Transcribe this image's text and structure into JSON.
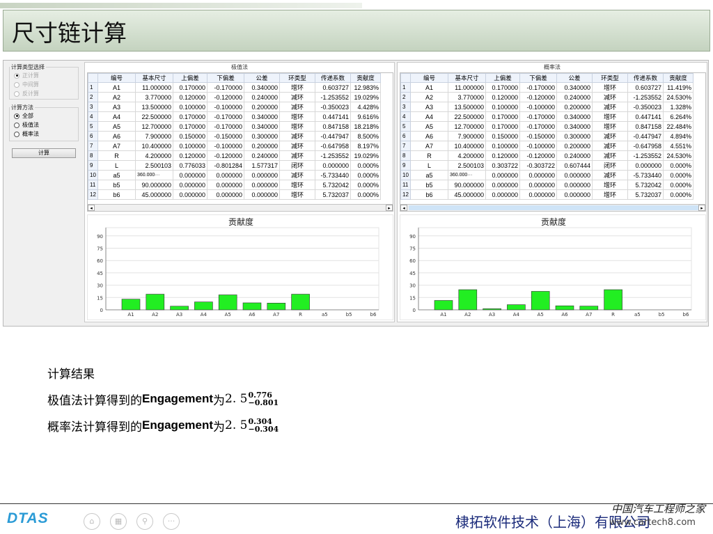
{
  "slide_title": "尺寸链计算",
  "left": {
    "group1_title": "计算类型选择",
    "group1_options": [
      "正计算",
      "中间算",
      "反计算"
    ],
    "group2_title": "计算方法",
    "group2_options": [
      "全部",
      "极值法",
      "概率法"
    ],
    "calc_button": "计算"
  },
  "table_headers": [
    "编号",
    "基本尺寸",
    "上偏差",
    "下偏差",
    "公差",
    "环类型",
    "传递系数",
    "贡献度"
  ],
  "extreme": {
    "title": "极值法",
    "rows": [
      [
        "1",
        "A1",
        "11.000000",
        "0.170000",
        "-0.170000",
        "0.340000",
        "增环",
        "0.603727",
        "12.983%"
      ],
      [
        "2",
        "A2",
        "3.770000",
        "0.120000",
        "-0.120000",
        "0.240000",
        "减环",
        "-1.253552",
        "19.029%"
      ],
      [
        "3",
        "A3",
        "13.500000",
        "0.100000",
        "-0.100000",
        "0.200000",
        "减环",
        "-0.350023",
        "4.428%"
      ],
      [
        "4",
        "A4",
        "22.500000",
        "0.170000",
        "-0.170000",
        "0.340000",
        "增环",
        "0.447141",
        "9.616%"
      ],
      [
        "5",
        "A5",
        "12.700000",
        "0.170000",
        "-0.170000",
        "0.340000",
        "增环",
        "0.847158",
        "18.218%"
      ],
      [
        "6",
        "A6",
        "7.900000",
        "0.150000",
        "-0.150000",
        "0.300000",
        "减环",
        "-0.447947",
        "8.500%"
      ],
      [
        "7",
        "A7",
        "10.400000",
        "0.100000",
        "-0.100000",
        "0.200000",
        "减环",
        "-0.647958",
        "8.197%"
      ],
      [
        "8",
        "R",
        "4.200000",
        "0.120000",
        "-0.120000",
        "0.240000",
        "减环",
        "-1.253552",
        "19.029%"
      ],
      [
        "9",
        "L",
        "2.500103",
        "0.776033",
        "-0.801284",
        "1.577317",
        "闭环",
        "0.000000",
        "0.000%"
      ],
      [
        "10",
        "a5",
        "360.000···",
        "0.000000",
        "0.000000",
        "0.000000",
        "减环",
        "-5.733440",
        "0.000%"
      ],
      [
        "11",
        "b5",
        "90.000000",
        "0.000000",
        "0.000000",
        "0.000000",
        "增环",
        "5.732042",
        "0.000%"
      ],
      [
        "12",
        "b6",
        "45.000000",
        "0.000000",
        "0.000000",
        "0.000000",
        "增环",
        "5.732037",
        "0.000%"
      ]
    ]
  },
  "probability": {
    "title": "概率法",
    "rows": [
      [
        "1",
        "A1",
        "11.000000",
        "0.170000",
        "-0.170000",
        "0.340000",
        "增环",
        "0.603727",
        "11.419%"
      ],
      [
        "2",
        "A2",
        "3.770000",
        "0.120000",
        "-0.120000",
        "0.240000",
        "减环",
        "-1.253552",
        "24.530%"
      ],
      [
        "3",
        "A3",
        "13.500000",
        "0.100000",
        "-0.100000",
        "0.200000",
        "减环",
        "-0.350023",
        "1.328%"
      ],
      [
        "4",
        "A4",
        "22.500000",
        "0.170000",
        "-0.170000",
        "0.340000",
        "增环",
        "0.447141",
        "6.264%"
      ],
      [
        "5",
        "A5",
        "12.700000",
        "0.170000",
        "-0.170000",
        "0.340000",
        "增环",
        "0.847158",
        "22.484%"
      ],
      [
        "6",
        "A6",
        "7.900000",
        "0.150000",
        "-0.150000",
        "0.300000",
        "减环",
        "-0.447947",
        "4.894%"
      ],
      [
        "7",
        "A7",
        "10.400000",
        "0.100000",
        "-0.100000",
        "0.200000",
        "减环",
        "-0.647958",
        "4.551%"
      ],
      [
        "8",
        "R",
        "4.200000",
        "0.120000",
        "-0.120000",
        "0.240000",
        "减环",
        "-1.253552",
        "24.530%"
      ],
      [
        "9",
        "L",
        "2.500103",
        "0.303722",
        "-0.303722",
        "0.607444",
        "闭环",
        "0.000000",
        "0.000%"
      ],
      [
        "10",
        "a5",
        "360.000···",
        "0.000000",
        "0.000000",
        "0.000000",
        "减环",
        "-5.733440",
        "0.000%"
      ],
      [
        "11",
        "b5",
        "90.000000",
        "0.000000",
        "0.000000",
        "0.000000",
        "增环",
        "5.732042",
        "0.000%"
      ],
      [
        "12",
        "b6",
        "45.000000",
        "0.000000",
        "0.000000",
        "0.000000",
        "增环",
        "5.732037",
        "0.000%"
      ]
    ]
  },
  "chart_data": [
    {
      "type": "bar",
      "title": "贡献度",
      "categories": [
        "A1",
        "A2",
        "A3",
        "A4",
        "A5",
        "A6",
        "A7",
        "R",
        "a5",
        "b5",
        "b6"
      ],
      "values": [
        12.983,
        19.029,
        4.428,
        9.616,
        18.218,
        8.5,
        8.197,
        19.029,
        0,
        0,
        0
      ],
      "yticks": [
        0,
        15,
        30,
        45,
        60,
        75,
        90
      ],
      "ylim": [
        0,
        100
      ],
      "grid": true,
      "bar_color": "#22ee22"
    },
    {
      "type": "bar",
      "title": "贡献度",
      "categories": [
        "A1",
        "A2",
        "A3",
        "A4",
        "A5",
        "A6",
        "A7",
        "R",
        "a5",
        "b5",
        "b6"
      ],
      "values": [
        11.419,
        24.53,
        1.328,
        6.264,
        22.484,
        4.894,
        4.551,
        24.53,
        0,
        0,
        0
      ],
      "yticks": [
        0,
        15,
        30,
        45,
        60,
        75,
        90
      ],
      "ylim": [
        0,
        100
      ],
      "grid": true,
      "bar_color": "#22ee22"
    }
  ],
  "results": {
    "heading": "计算结果",
    "line1_prefix": "极值法计算得到的",
    "line2_prefix": "概率法计算得到的",
    "engagement": "Engagement",
    "wei": "为",
    "line1_value": "2. 5",
    "line1_upper": "0.776",
    "line1_lower": "−0.801",
    "line2_value": "2. 5",
    "line2_upper": "0.304",
    "line2_lower": "−0.304"
  },
  "footer": {
    "logo": "DTAS",
    "company": "棣拓软件技术（上海）有限公司",
    "watermark_top": "中国汽车工程师之家",
    "watermark_url": "www.cartech8.com",
    "nav_icons": [
      "home-icon",
      "gallery-icon",
      "zoom-icon",
      "more-icon"
    ],
    "nav_glyphs": [
      "⌂",
      "▦",
      "⚲",
      "···"
    ]
  }
}
